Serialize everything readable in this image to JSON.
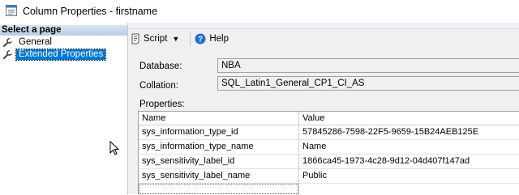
{
  "window": {
    "title": "Column Properties - firstname"
  },
  "left_pane": {
    "header": "Select a page",
    "pages": [
      {
        "label": "General",
        "selected": false
      },
      {
        "label": "Extended Properties",
        "selected": true
      }
    ]
  },
  "toolbar": {
    "script_label": "Script",
    "help_label": "Help"
  },
  "form": {
    "database_label": "Database:",
    "database_value": "NBA",
    "collation_label": "Collation:",
    "collation_value": "SQL_Latin1_General_CP1_CI_AS",
    "properties_label": "Properties:"
  },
  "grid": {
    "columns": [
      "Name",
      "Value"
    ],
    "rows": [
      {
        "name": "sys_information_type_id",
        "value": "57845286-7598-22F5-9659-15B24AEB125E"
      },
      {
        "name": "sys_information_type_name",
        "value": "Name"
      },
      {
        "name": "sys_sensitivity_label_id",
        "value": "1866ca45-1973-4c28-9d12-04d407f147ad"
      },
      {
        "name": "sys_sensitivity_label_name",
        "value": "Public"
      }
    ]
  },
  "colors": {
    "selection": "#0078d7",
    "help_icon": "#1f6fd1"
  }
}
